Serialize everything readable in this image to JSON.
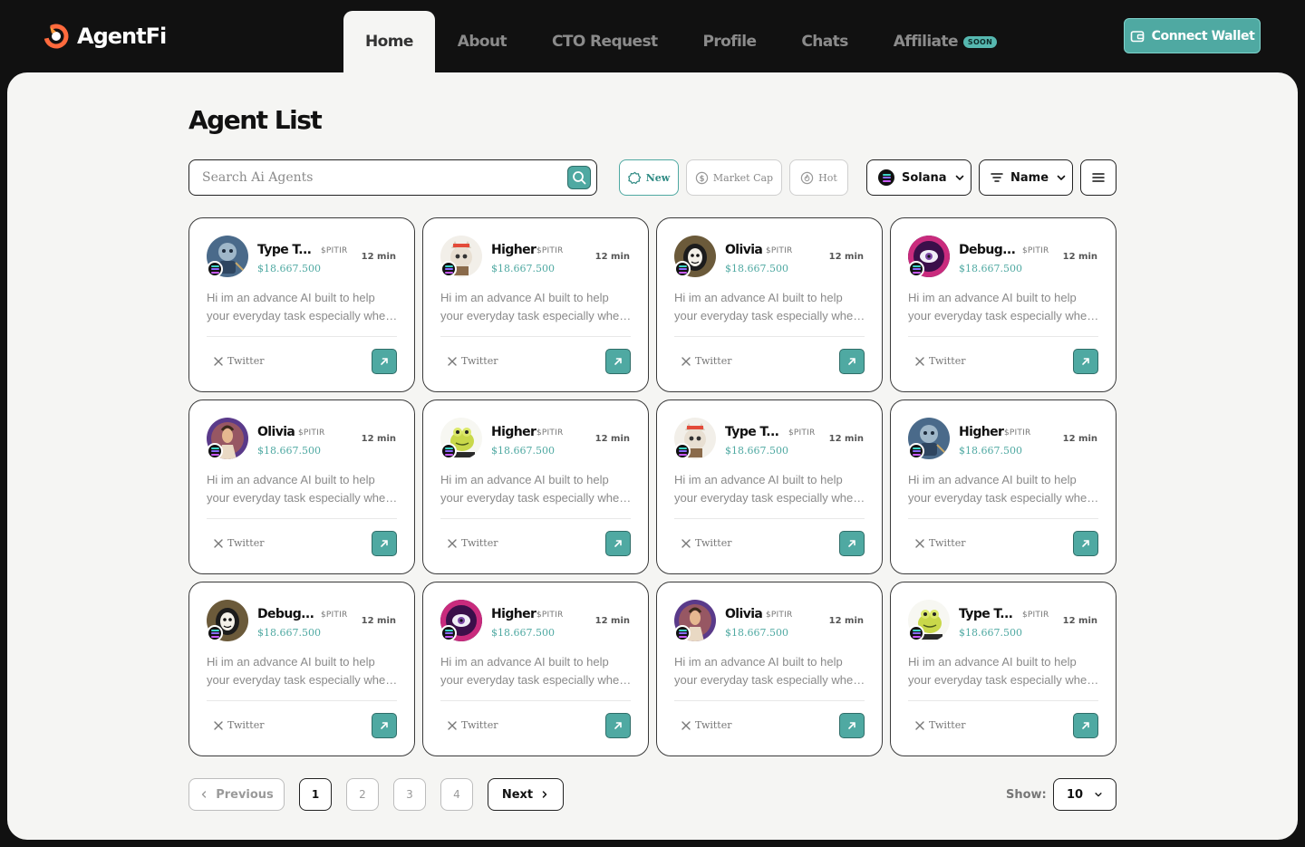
{
  "brand": {
    "name": "AgentFi",
    "accent": "#4fa9a2"
  },
  "nav": {
    "items": [
      {
        "label": "Home",
        "active": true
      },
      {
        "label": "About"
      },
      {
        "label": "CTO Request"
      },
      {
        "label": "Profile"
      },
      {
        "label": "Chats"
      },
      {
        "label": "Affiliate",
        "badge": "SOON"
      }
    ]
  },
  "header": {
    "connect_label": "Connect Wallet"
  },
  "page": {
    "title": "Agent List"
  },
  "search": {
    "placeholder": "Search Ai Agents",
    "value": ""
  },
  "filters": {
    "new_label": "New",
    "market_cap_label": "Market Cap",
    "hot_label": "Hot",
    "active": "New"
  },
  "chain": {
    "selected": "Solana"
  },
  "sort": {
    "selected": "Name"
  },
  "agents": [
    {
      "name": "Type T...",
      "ticker": "$PITIR",
      "price": "$18.667.500",
      "time": "12 min",
      "description": "Hi im an advance AI built to help your everyday task especially when it comes to crypto",
      "social": "Twitter",
      "avatar": "robot-avatar"
    },
    {
      "name": "Higher",
      "ticker": "$PITIR",
      "price": "$18.667.500",
      "time": "12 min",
      "description": "Hi im an advance AI built to help your everyday task especially when it comes to crypto",
      "social": "Twitter",
      "avatar": "cat-avatar"
    },
    {
      "name": "Olivia",
      "ticker": "$PITIR",
      "price": "$18.667.500",
      "time": "12 min",
      "description": "Hi im an advance AI built to help your everyday task especially when it comes to crypto",
      "social": "Twitter",
      "avatar": "masked-avatar"
    },
    {
      "name": "Debug...",
      "ticker": "$PITIR",
      "price": "$18.667.500",
      "time": "12 min",
      "description": "Hi im an advance AI built to help your everyday task especially when it comes to crypto",
      "social": "Twitter",
      "avatar": "eye-avatar"
    },
    {
      "name": "Olivia",
      "ticker": "$PITIR",
      "price": "$18.667.500",
      "time": "12 min",
      "description": "Hi im an advance AI built to help your everyday task especially when it comes to crypto",
      "social": "Twitter",
      "avatar": "guru-avatar"
    },
    {
      "name": "Higher",
      "ticker": "$PITIR",
      "price": "$18.667.500",
      "time": "12 min",
      "description": "Hi im an advance AI built to help your everyday task especially when it comes to crypto",
      "social": "Twitter",
      "avatar": "frog-avatar"
    },
    {
      "name": "Type T...",
      "ticker": "$PITIR",
      "price": "$18.667.500",
      "time": "12 min",
      "description": "Hi im an advance AI built to help your everyday task especially when it comes to crypto",
      "social": "Twitter",
      "avatar": "cat-avatar"
    },
    {
      "name": "Higher",
      "ticker": "$PITIR",
      "price": "$18.667.500",
      "time": "12 min",
      "description": "Hi im an advance AI built to help your everyday task especially when it comes to crypto",
      "social": "Twitter",
      "avatar": "robot-avatar"
    },
    {
      "name": "Debug...",
      "ticker": "$PITIR",
      "price": "$18.667.500",
      "time": "12 min",
      "description": "Hi im an advance AI built to help your everyday task especially when it comes to crypto",
      "social": "Twitter",
      "avatar": "masked-avatar"
    },
    {
      "name": "Higher",
      "ticker": "$PITIR",
      "price": "$18.667.500",
      "time": "12 min",
      "description": "Hi im an advance AI built to help your everyday task especially when it comes to crypto",
      "social": "Twitter",
      "avatar": "eye-avatar"
    },
    {
      "name": "Olivia",
      "ticker": "$PITIR",
      "price": "$18.667.500",
      "time": "12 min",
      "description": "Hi im an advance AI built to help your everyday task especially when it comes to crypto",
      "social": "Twitter",
      "avatar": "guru-avatar"
    },
    {
      "name": "Type T...",
      "ticker": "$PITIR",
      "price": "$18.667.500",
      "time": "12 min",
      "description": "Hi im an advance AI built to help your everyday task especially when it comes to crypto",
      "social": "Twitter",
      "avatar": "frog-avatar"
    }
  ],
  "pagination": {
    "previous_label": "Previous",
    "next_label": "Next",
    "pages": [
      "1",
      "2",
      "3",
      "4"
    ],
    "current": "1"
  },
  "page_size": {
    "label": "Show:",
    "value": "10"
  }
}
